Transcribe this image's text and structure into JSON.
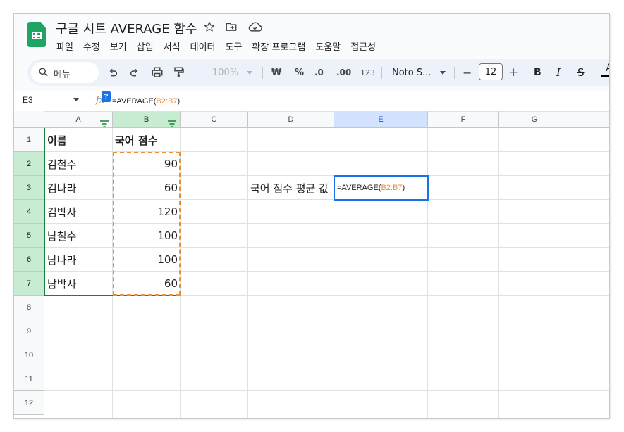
{
  "app": {
    "title": "구글 시트 AVERAGE 함수",
    "brand_color": "#1fa463"
  },
  "menu": [
    "파일",
    "수정",
    "보기",
    "삽입",
    "서식",
    "데이터",
    "도구",
    "확장 프로그램",
    "도움말",
    "접근성"
  ],
  "toolbar": {
    "search_label": "메뉴",
    "zoom": "100%",
    "currency": "₩",
    "percent": "%",
    "decrease_decimal": ".0",
    "increase_decimal": ".00",
    "number_format": "123",
    "font_name": "Noto S...",
    "font_size": "12",
    "minus": "−",
    "plus": "+",
    "bold": "B",
    "italic": "I",
    "strike": "S",
    "text_color": "A"
  },
  "formula_bar": {
    "name_box": "E3",
    "fx": "fx",
    "help": "?",
    "formula_prefix": "=AVERAGE(",
    "formula_ref": "B2:B7",
    "formula_suffix": ")"
  },
  "sheet": {
    "columns": [
      "A",
      "B",
      "C",
      "D",
      "E",
      "F",
      "G"
    ],
    "rows": [
      "1",
      "2",
      "3",
      "4",
      "5",
      "6",
      "7",
      "8",
      "9",
      "10",
      "11",
      "12"
    ],
    "header": {
      "name": "이름",
      "score": "국어 점수"
    },
    "data": [
      {
        "name": "김철수",
        "score": "90"
      },
      {
        "name": "김나라",
        "score": "60"
      },
      {
        "name": "김박사",
        "score": "120"
      },
      {
        "name": "남철수",
        "score": "100"
      },
      {
        "name": "남나라",
        "score": "100"
      },
      {
        "name": "남박사",
        "score": "60"
      }
    ],
    "avg_label": "국어 점수 평균 값",
    "active_cell": {
      "prefix": "=AVERAGE(",
      "ref": "B2:B7",
      "suffix": ")"
    },
    "ref_color": "#e69138",
    "active_color": "#1a73e8",
    "range_color": "#188038"
  }
}
